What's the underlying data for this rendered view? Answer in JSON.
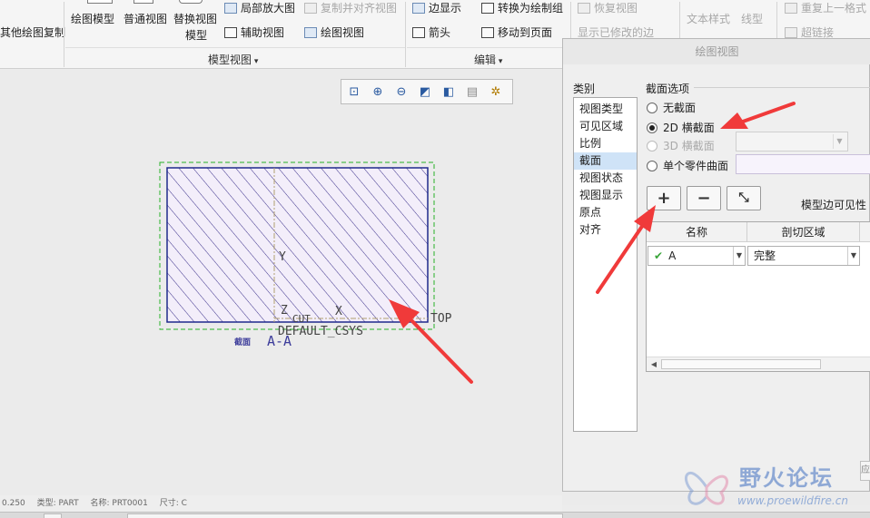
{
  "ribbon": {
    "row1": {
      "copy_label": "其他绘图复制",
      "general_view": "绘图模型",
      "normal_view": "普通视图",
      "replace_view": "替换视图",
      "replace_view_line2": "模型",
      "detail_view": "局部放大图",
      "copy_align_view": "复制并对齐视图",
      "auxiliary_view": "辅助视图",
      "drawing_view": "绘图视图",
      "edge_display": "边显示",
      "convert_to_group": "转换为绘制组",
      "arrow": "箭头",
      "move_to_page": "移动到页面",
      "restore_view": "恢复视图",
      "show_modified_edges": "显示已修改的边",
      "text_style": "文本样式",
      "line_style": "线型",
      "repeat_last_format": "重复上一格式",
      "hyperlink": "超链接"
    },
    "groups": {
      "model_views": "模型视图",
      "edit": "编辑"
    }
  },
  "canvas": {
    "label_y": "Y",
    "label_z": "Z",
    "label_x": "X",
    "label_top": "TOP",
    "label_cut": "CUT",
    "label_default_csys": "DEFAULT_CSYS",
    "section_label": "截面",
    "section_name": "A-A"
  },
  "dialog": {
    "title": "绘图视图",
    "category_heading": "类别",
    "categories": [
      "视图类型",
      "可见区域",
      "比例",
      "截面",
      "视图状态",
      "视图显示",
      "原点",
      "对齐"
    ],
    "selected_category_index": 3,
    "section_options_heading": "截面选项",
    "options": {
      "none": "无截面",
      "xsec_2d": "2D 横截面",
      "xsec_3d": "3D 横截面",
      "single_part_surface": "单个零件曲面"
    },
    "selected_option": "xsec_2d",
    "add_button": "+",
    "remove_button": "−",
    "model_edge_visibility": "模型边可见性",
    "table": {
      "columns": [
        "名称",
        "剖切区域"
      ],
      "rows": [
        {
          "name": "A",
          "region": "完整",
          "checked": true
        }
      ]
    },
    "bottom_button": "应"
  },
  "status": {
    "items": [
      "0.250",
      "类型: PART",
      "名称: PRT0001",
      "尺寸: C"
    ]
  },
  "watermark": {
    "title": "野火论坛",
    "url": "www.proewildfire.cn"
  },
  "colors": {
    "hatch": "#3a2f8a",
    "hatch_fill": "#f3eefa",
    "dashed_boundary": "#27b127",
    "annotation_arrow": "#f03a3a",
    "selected_category_bg": "#cfe3f7",
    "watermark_blue": "#3f6fc0"
  }
}
